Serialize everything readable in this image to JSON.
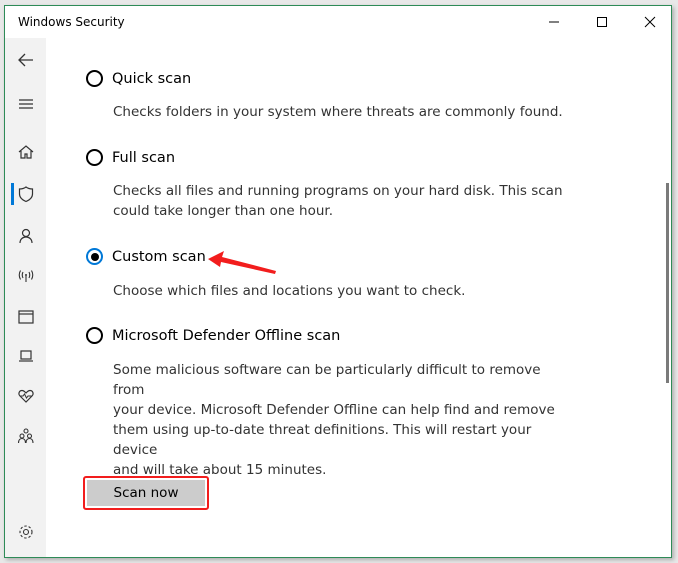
{
  "window": {
    "title": "Windows Security",
    "controls": [
      "minimize",
      "maximize",
      "close"
    ]
  },
  "sidebar": {
    "items": [
      {
        "name": "back",
        "icon": "back-arrow-icon"
      },
      {
        "name": "menu",
        "icon": "hamburger-icon"
      },
      {
        "name": "home",
        "icon": "home-icon"
      },
      {
        "name": "virus-threat-protection",
        "icon": "shield-icon",
        "active": true
      },
      {
        "name": "account-protection",
        "icon": "person-icon"
      },
      {
        "name": "firewall-network",
        "icon": "wireless-icon"
      },
      {
        "name": "app-browser-control",
        "icon": "browser-window-icon"
      },
      {
        "name": "device-security",
        "icon": "laptop-icon"
      },
      {
        "name": "device-performance-health",
        "icon": "heart-icon"
      },
      {
        "name": "family-options",
        "icon": "family-icon"
      },
      {
        "name": "settings",
        "icon": "gear-icon"
      }
    ],
    "accent": "#0078d7"
  },
  "scan_options": [
    {
      "label": "Quick scan",
      "checked": false,
      "description": [
        "Checks folders in your system where threats are commonly found."
      ]
    },
    {
      "label": "Full scan",
      "checked": false,
      "description": [
        "Checks all files and running programs on your hard disk. This scan",
        "could take longer than one hour."
      ]
    },
    {
      "label": "Custom scan",
      "checked": true,
      "description": [
        "Choose which files and locations you want to check."
      ]
    },
    {
      "label": "Microsoft Defender Offline scan",
      "checked": false,
      "description": [
        "Some malicious software can be particularly difficult to remove from",
        "your device. Microsoft Defender Offline can help find and remove",
        "them using up-to-date threat definitions. This will restart your device",
        "and will take about 15 minutes."
      ]
    }
  ],
  "scan_button": {
    "label": "Scan now"
  },
  "annotations": {
    "highlight_color": "#f21d1d",
    "arrow_target": "Custom scan"
  }
}
